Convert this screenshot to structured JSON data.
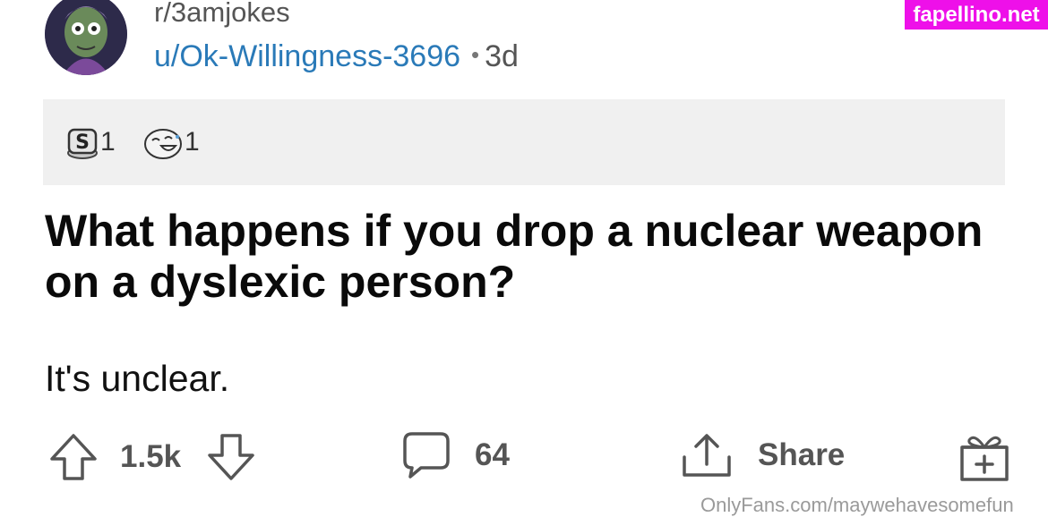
{
  "post": {
    "subreddit": "r/3amjokes",
    "username": "u/Ok-Willingness-3696",
    "separator": "•",
    "age": "3d",
    "title": "What happens if you drop a nuclear weapon on a dyslexic person?",
    "body": "It's unclear."
  },
  "awards": [
    {
      "icon": "silver-award-icon",
      "count": "1"
    },
    {
      "icon": "laughing-face-award-icon",
      "count": "1"
    }
  ],
  "actions": {
    "upvote_icon": "upvote-arrow-icon",
    "votes": "1.5k",
    "downvote_icon": "downvote-arrow-icon",
    "comment_icon": "comment-bubble-icon",
    "comments": "64",
    "share_icon": "share-icon",
    "share_label": "Share",
    "award_icon": "gift-icon"
  },
  "watermarks": {
    "top_right": "fapellino.net",
    "bottom": "OnlyFans.com/maywehavesomefun"
  },
  "colors": {
    "username": "#2a7ab8",
    "watermark_bg": "#ee10e9",
    "awards_bg": "#f0f0f0",
    "action_gray": "#555555"
  }
}
